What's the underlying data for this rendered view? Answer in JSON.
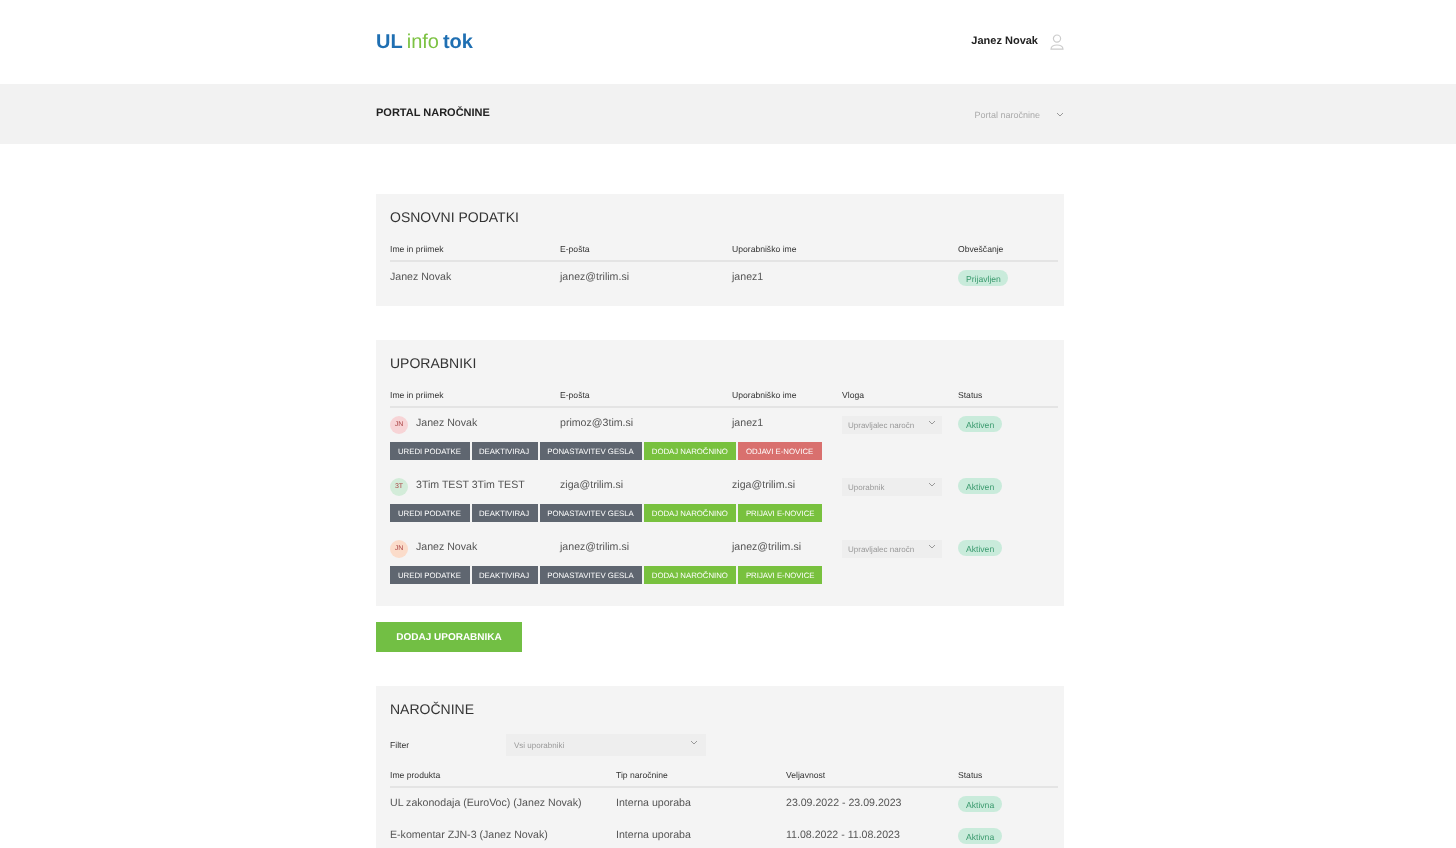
{
  "header": {
    "logo": {
      "part_1": "UL",
      "part_2": "info",
      "part_3": "tok"
    },
    "user_name": "Janez Novak"
  },
  "page_bar": {
    "title": "PORTAL NAROČNINE",
    "selector": "Portal naročnine"
  },
  "basic_data": {
    "title": "OSNOVNI PODATKI",
    "columns": [
      "Ime in priimek",
      "E-pošta",
      "Uporabniško ime",
      "Obveščanje"
    ],
    "row": {
      "name": "Janez Novak",
      "email": "janez@trilim.si",
      "username": "janez1",
      "notification": "Prijavljen"
    }
  },
  "users": {
    "title": "UPORABNIKI",
    "columns": [
      "Ime in priimek",
      "E-pošta",
      "Uporabniško ime",
      "Vloga",
      "Status"
    ],
    "rows": [
      {
        "initials": "JN",
        "color": "#f7d4d6",
        "name": "Janez Novak",
        "email": "primoz@3tim.si",
        "username": "janez1",
        "role": "Upravljalec naročn",
        "status": "Aktiven",
        "actions": [
          {
            "label": "UREDI PODATKE",
            "kind": "dark"
          },
          {
            "label": "DEAKTIVIRAJ",
            "kind": "dark"
          },
          {
            "label": "PONASTAVITEV GESLA",
            "kind": "dark"
          },
          {
            "label": "DODAJ NAROČNINO",
            "kind": "green"
          },
          {
            "label": "ODJAVI E-NOVICE",
            "kind": "red"
          }
        ]
      },
      {
        "initials": "3T",
        "color": "#d3ecd9",
        "name": "3Tim TEST 3Tim TEST",
        "email": "ziga@trilim.si",
        "username": "ziga@trilim.si",
        "role": "Uporabnik",
        "status": "Aktiven",
        "actions": [
          {
            "label": "UREDI PODATKE",
            "kind": "dark"
          },
          {
            "label": "DEAKTIVIRAJ",
            "kind": "dark"
          },
          {
            "label": "PONASTAVITEV GESLA",
            "kind": "dark"
          },
          {
            "label": "DODAJ NAROČNINO",
            "kind": "green"
          },
          {
            "label": "PRIJAVI E-NOVICE",
            "kind": "green"
          }
        ]
      },
      {
        "initials": "JN",
        "color": "#fbdcca",
        "name": "Janez Novak",
        "email": "janez@trilim.si",
        "username": "janez@trilim.si",
        "role": "Upravljalec naročn",
        "status": "Aktiven",
        "actions": [
          {
            "label": "UREDI PODATKE",
            "kind": "dark"
          },
          {
            "label": "DEAKTIVIRAJ",
            "kind": "dark"
          },
          {
            "label": "PONASTAVITEV GESLA",
            "kind": "dark"
          },
          {
            "label": "DODAJ NAROČNINO",
            "kind": "green"
          },
          {
            "label": "PRIJAVI E-NOVICE",
            "kind": "green"
          }
        ]
      }
    ]
  },
  "add_user_button": "DODAJ UPORABNIKA",
  "subscriptions": {
    "title": "NAROČNINE",
    "filter_label": "Filter",
    "filter_placeholder": "Vsi uporabniki",
    "columns": [
      "Ime produkta",
      "Tip naročnine",
      "Veljavnost",
      "Status"
    ],
    "rows": [
      {
        "product": "UL zakonodaja (EuroVoc) (Janez Novak)",
        "type": "Interna uporaba",
        "validity": "23.09.2022 - 23.09.2023",
        "status": "Aktivna"
      },
      {
        "product": "E-komentar ZJN-3 (Janez Novak)",
        "type": "Interna uporaba",
        "validity": "11.08.2022 - 11.08.2023",
        "status": "Aktivna"
      }
    ]
  }
}
